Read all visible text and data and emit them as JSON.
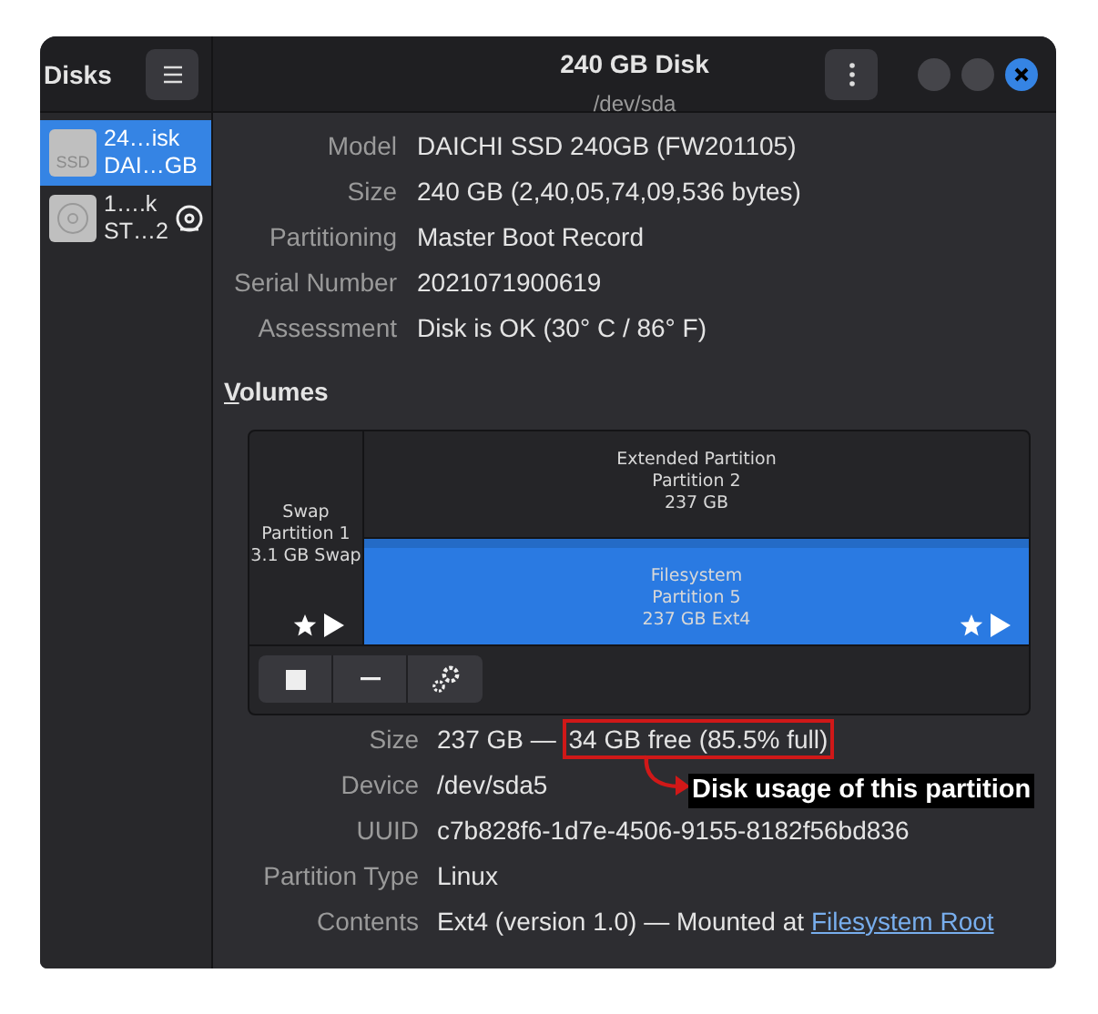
{
  "sidebar": {
    "title": "Disks",
    "items": [
      {
        "kind": "ssd",
        "icon_label": "SSD",
        "name": "24…isk",
        "detail": "DAI…GB",
        "selected": true
      },
      {
        "kind": "hdd",
        "name": "1….k",
        "detail": "ST…2",
        "selected": false
      }
    ]
  },
  "header": {
    "title": "240 GB Disk",
    "subtitle": "/dev/sda"
  },
  "disk_info": [
    {
      "label": "Model",
      "value": "DAICHI SSD 240GB (FW201105)"
    },
    {
      "label": "Size",
      "value": "240 GB (2,40,05,74,09,536 bytes)"
    },
    {
      "label": "Partitioning",
      "value": "Master Boot Record"
    },
    {
      "label": "Serial Number",
      "value": "2021071900619"
    },
    {
      "label": "Assessment",
      "value": "Disk is OK (30° C / 86° F)"
    }
  ],
  "volumes": {
    "heading": "Volumes",
    "partitions": [
      {
        "kind": "primary",
        "lines": [
          "Swap",
          "Partition 1",
          "3.1 GB Swap"
        ],
        "selected": false
      },
      {
        "kind": "extended",
        "lines": [
          "Extended Partition",
          "Partition 2",
          "237 GB"
        ],
        "children": [
          {
            "kind": "logical",
            "lines": [
              "Filesystem",
              "Partition 5",
              "237 GB Ext4"
            ],
            "selected": true
          }
        ]
      }
    ],
    "toolbar": [
      {
        "kind": "stop"
      },
      {
        "kind": "minus"
      },
      {
        "kind": "gears"
      }
    ]
  },
  "volume_info": [
    {
      "label": "Size",
      "value": "237 GB —",
      "highlight": "34 GB free (85.5% full)"
    },
    {
      "label": "Device",
      "value": "/dev/sda5"
    },
    {
      "label": "UUID",
      "value": "c7b828f6-1d7e-4506-9155-8182f56bd836"
    },
    {
      "label": "Partition Type",
      "value": "Linux"
    },
    {
      "label": "Contents",
      "value": "Ext4 (version 1.0) — Mounted at",
      "link": "Filesystem Root"
    }
  ],
  "annotation": {
    "text": "Disk usage of this partition"
  }
}
